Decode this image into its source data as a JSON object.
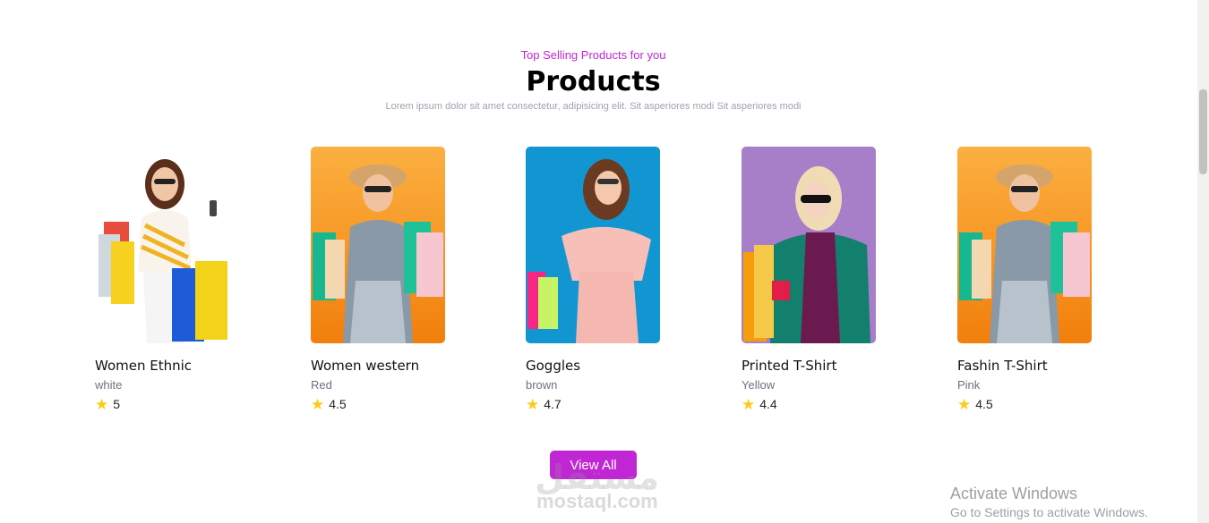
{
  "header": {
    "subtitle": "Top Selling Products for you",
    "title": "Products",
    "description": "Lorem ipsum dolor sit amet consectetur, adipisicing elit. Sit asperiores modi Sit asperiores modi"
  },
  "products": [
    {
      "name": "Women Ethnic",
      "color": "white",
      "rating": "5"
    },
    {
      "name": "Women western",
      "color": "Red",
      "rating": "4.5"
    },
    {
      "name": "Goggles",
      "color": "brown",
      "rating": "4.7"
    },
    {
      "name": "Printed T-Shirt",
      "color": "Yellow",
      "rating": "4.4"
    },
    {
      "name": "Fashin T-Shirt",
      "color": "Pink",
      "rating": "4.5"
    }
  ],
  "icons": {
    "rating": "star-icon"
  },
  "actions": {
    "view_all_label": "View All"
  },
  "watermark": {
    "arabic": "مستقل",
    "latin": "mostaql.com"
  },
  "os_notice": {
    "line1": "Activate Windows",
    "line2": "Go to Settings to activate Windows."
  },
  "colors": {
    "accent": "#c026d3",
    "star": "#facc15"
  }
}
